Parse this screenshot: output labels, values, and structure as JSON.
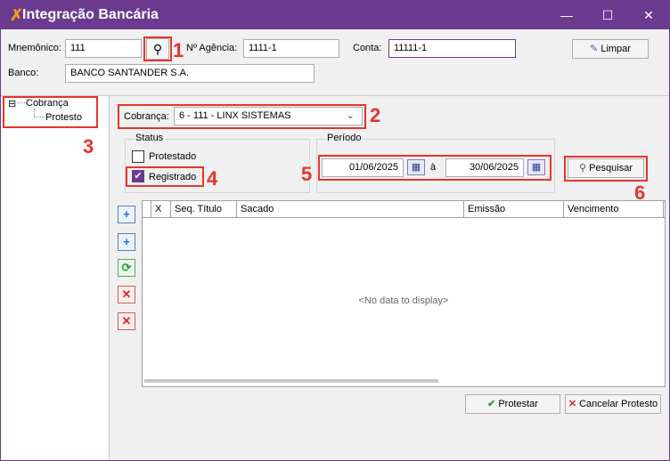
{
  "window": {
    "title": "Integração Bancária",
    "app_icon": "lightning-icon",
    "minimize_glyph": "—",
    "maximize_glyph": "☐",
    "close_glyph": "✕"
  },
  "header": {
    "mnemonico_label": "Mnemônico:",
    "mnemonico_value": "111",
    "agencia_label": "Nº Agência:",
    "agencia_value": "1111-1",
    "conta_label": "Conta:",
    "conta_value": "11111-1",
    "limpar_label": "Limpar",
    "banco_label": "Banco:",
    "banco_value": "BANCO SANTANDER S.A."
  },
  "tree": {
    "root_toggle": "⊟",
    "root": "Cobrança",
    "child": "Protesto"
  },
  "filters": {
    "cobranca_label": "Cobrança:",
    "cobranca_value": "6 - 111 - LINX SISTEMAS",
    "status_title": "Status",
    "protestado_label": "Protestado",
    "protestado_checked": false,
    "registrado_label": "Registrado",
    "registrado_checked": true,
    "check_glyph": "✔",
    "periodo_title": "Período",
    "date_from": "01/06/2025",
    "date_sep": "à",
    "date_to": "30/06/2025",
    "pesquisar_label": "Pesquisar"
  },
  "grid": {
    "columns": [
      "X",
      "Seq. Título",
      "Sacado",
      "Emissão",
      "Vencimento"
    ],
    "empty_text": "<No data to display>"
  },
  "side_toolbar": {
    "glyphs": [
      "+",
      "+",
      "⟳",
      "✕",
      "✕"
    ]
  },
  "footer": {
    "protestar_label": "Protestar",
    "cancelar_label": "Cancelar Protesto"
  },
  "annotations": [
    "1",
    "2",
    "3",
    "4",
    "5",
    "6"
  ],
  "colors": {
    "titlebar": "#6b3b8f",
    "annotation": "#e5352b"
  }
}
